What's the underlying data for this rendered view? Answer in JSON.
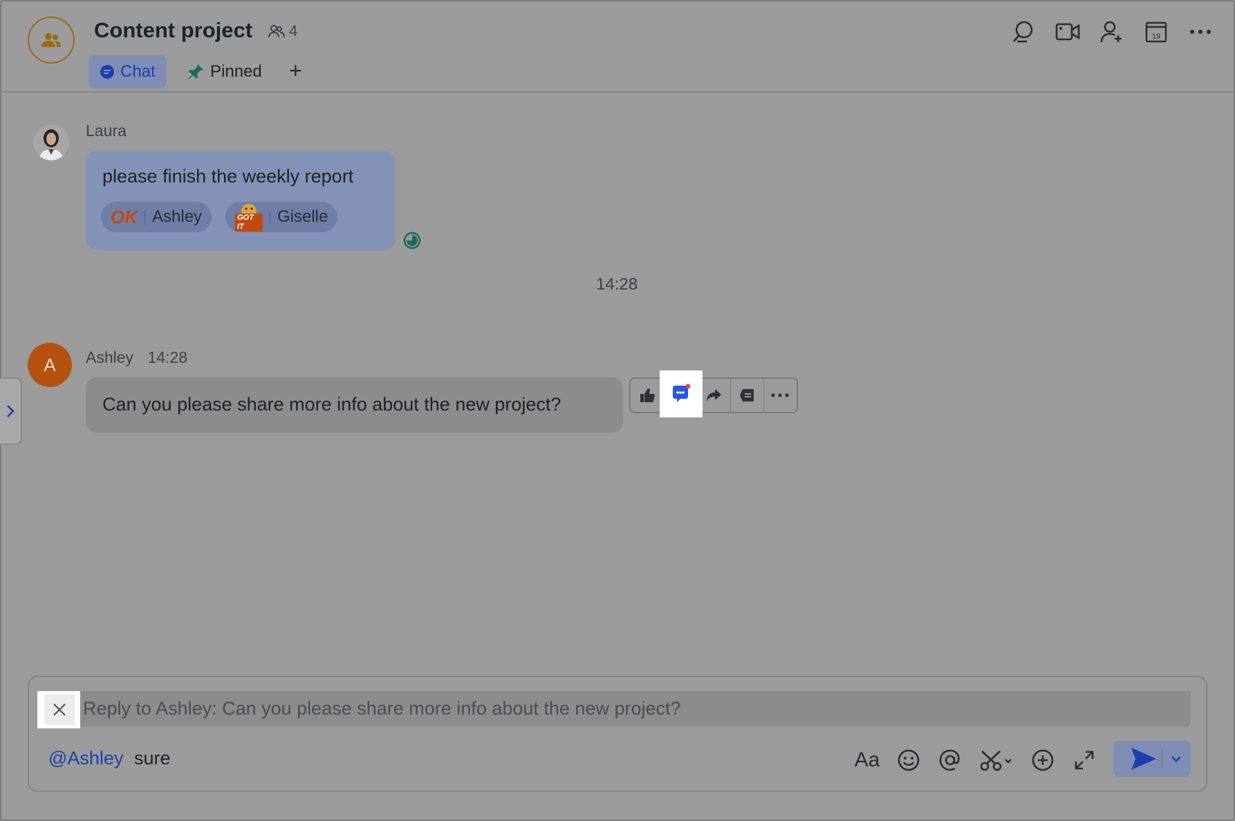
{
  "header": {
    "title": "Content project",
    "member_count": "4",
    "tabs": [
      {
        "label": "Chat",
        "icon": "chat-bubble-icon"
      },
      {
        "label": "Pinned",
        "icon": "pin-icon"
      }
    ],
    "add_tab_label": "+",
    "actions": [
      "search-icon",
      "video-call-icon",
      "add-member-icon",
      "calendar-icon",
      "more-icon"
    ],
    "calendar_day": "19"
  },
  "messages": [
    {
      "sender": "Laura",
      "text": "please finish the weekly report",
      "reactions": [
        {
          "sticker": "OK",
          "user": "Ashley"
        },
        {
          "sticker": "GOT IT",
          "user": "Giselle"
        }
      ]
    },
    {
      "time_divider": "14:28"
    },
    {
      "sender": "Ashley",
      "avatar_letter": "A",
      "time": "14:28",
      "text": "Can you please share more info about the new project?"
    }
  ],
  "message_toolbar": [
    "thumbs-up-icon",
    "reply-thread-icon",
    "forward-icon",
    "quote-reply-icon",
    "more-icon"
  ],
  "composer": {
    "reply_preview": "Reply to Ashley: Can you please share more info about the new project?",
    "mention": "@Ashley",
    "draft_text": "sure",
    "tools": [
      "text-format-icon",
      "emoji-icon",
      "mention-icon",
      "screenshot-icon",
      "add-icon",
      "expand-icon"
    ],
    "format_label": "Aa"
  },
  "colors": {
    "accent": "#1d3fb0",
    "overlay": "#9b9b9b",
    "ashley_avatar": "#b5520f",
    "group_avatar_ring": "#9a6a10"
  }
}
